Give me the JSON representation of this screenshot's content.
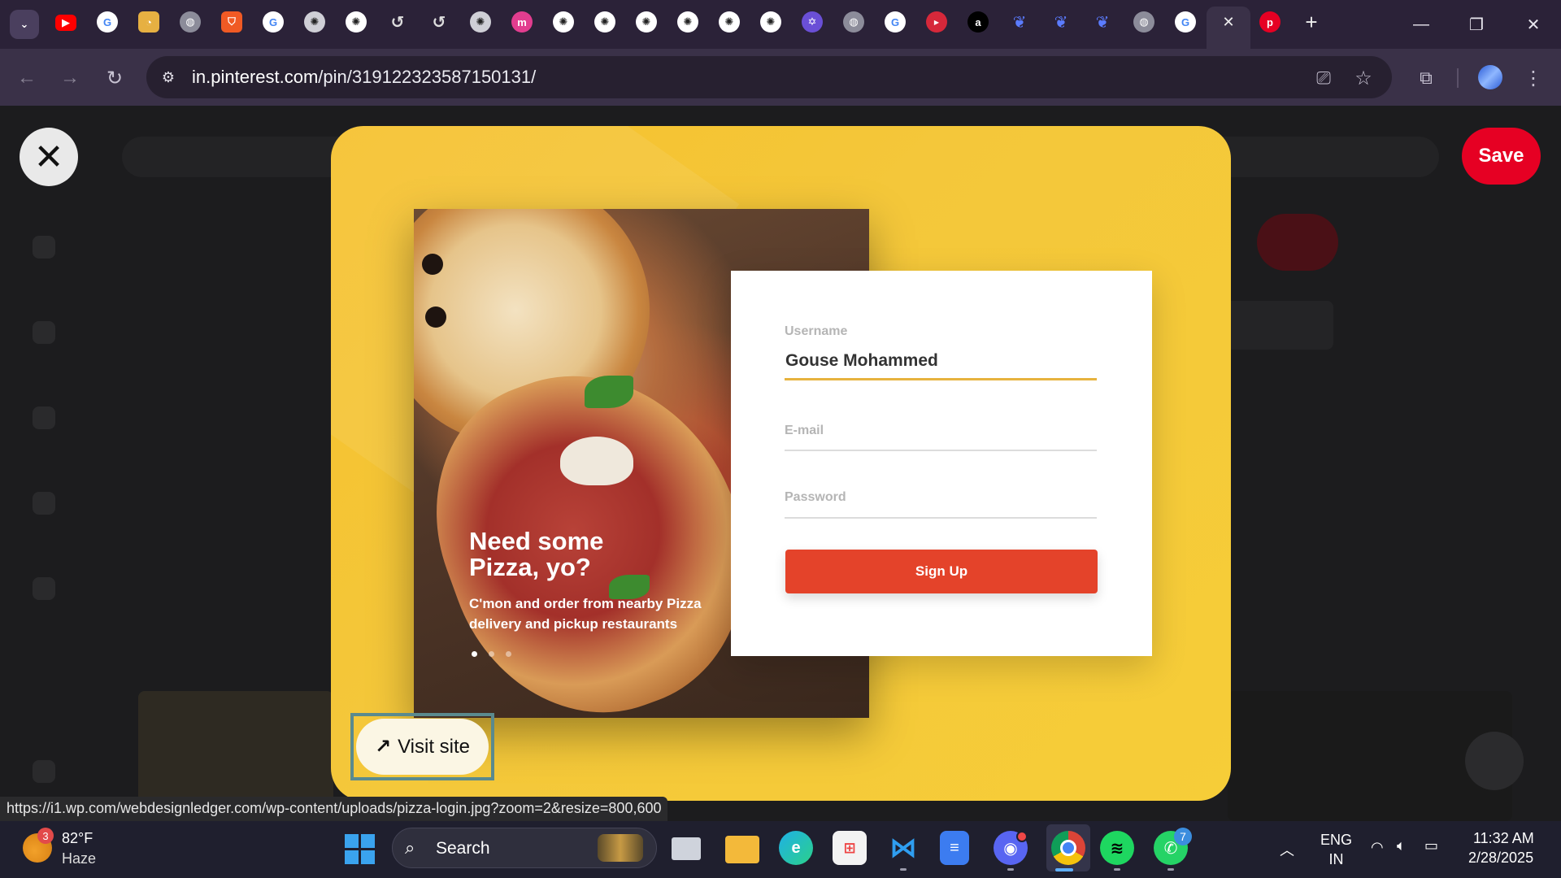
{
  "browser": {
    "url_domain": "in.pinterest.com",
    "url_path": "/pin/319122323587150131/",
    "tab_icons": [
      "tab-search-icon",
      "youtube-icon",
      "google-icon",
      "lens-icon",
      "globe-icon",
      "brave-icon",
      "google-icon",
      "chatgpt-icon",
      "chatgpt-icon",
      "history-icon",
      "history-icon",
      "chatgpt-icon",
      "meesho-icon",
      "chatgpt-icon",
      "chatgpt-icon",
      "chatgpt-icon",
      "chatgpt-icon",
      "chatgpt-icon",
      "chatgpt-icon",
      "star-app-icon",
      "globe-icon",
      "google-icon",
      "youtube-alt-icon",
      "threads-icon",
      "deepseek-icon",
      "deepseek-icon",
      "deepseek-icon",
      "globe-icon",
      "google-icon",
      "close-icon",
      "pinterest-icon",
      "new-tab-icon"
    ],
    "new_tab_label": "+",
    "minimize_label": "—",
    "restore_label": "❐",
    "close_label": "✕"
  },
  "pin": {
    "save_label": "Save",
    "close_label": "✕",
    "visit_site_label": "Visit site",
    "visit_site_arrow": "↗",
    "photo_heading": "Need some Pizza, yo?",
    "photo_sub": "C'mon and order from nearby Pizza delivery and pickup restaurants",
    "form": {
      "username_label": "Username",
      "username_value": "Gouse Mohammed",
      "email_label": "E-mail",
      "password_label": "Password",
      "signup_label": "Sign Up"
    }
  },
  "status_url": "https://i1.wp.com/webdesignledger.com/wp-content/uploads/pizza-login.jpg?zoom=2&resize=800,600",
  "taskbar": {
    "weather_badge": "3",
    "weather_temp": "82°F",
    "weather_desc": "Haze",
    "search_placeholder": "Search",
    "whatsapp_badge": "7",
    "lang_top": "ENG",
    "lang_bottom": "IN",
    "time": "11:32 AM",
    "date": "2/28/2025"
  },
  "colors": {
    "pinterest_red": "#e60023",
    "card_yellow": "#f6c12c",
    "signup_red": "#e4432a",
    "input_underline": "#e7b33e"
  }
}
